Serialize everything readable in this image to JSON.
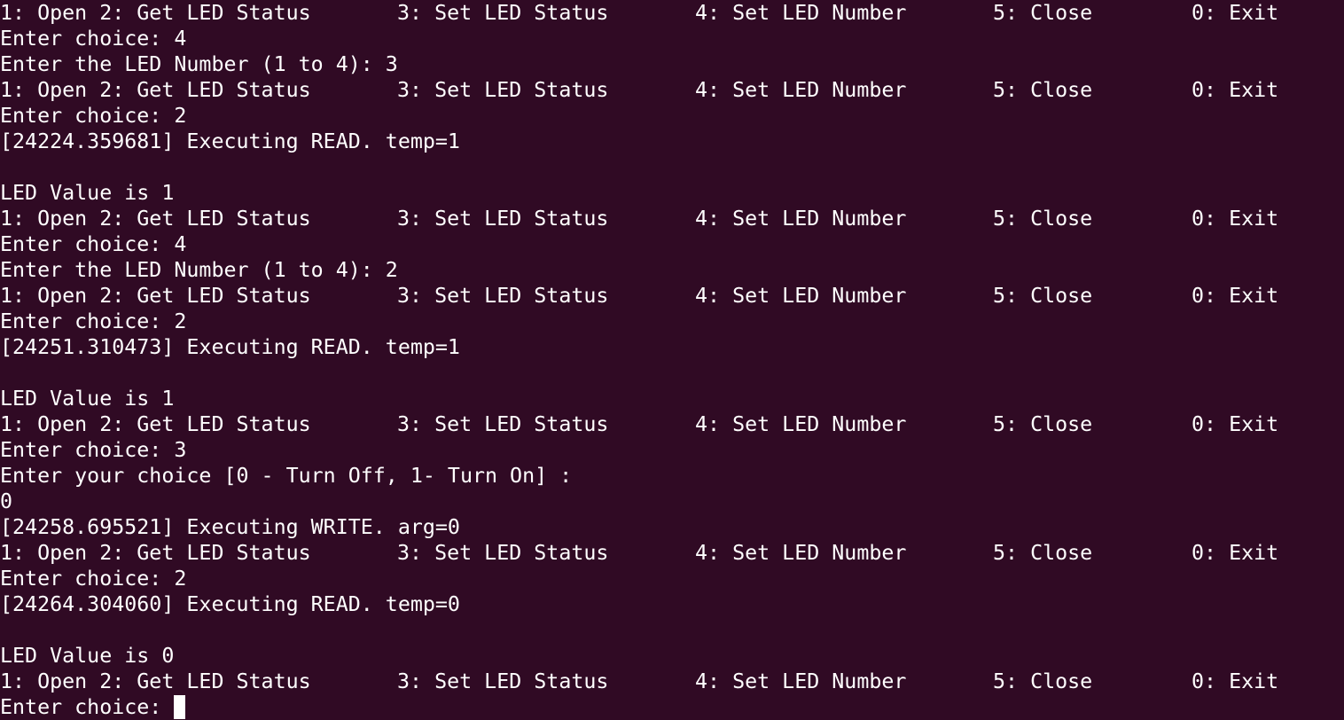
{
  "menu": {
    "item1": "1: Open 2: Get LED Status",
    "item3": "3: Set LED Status",
    "item4": "4: Set LED Number",
    "item5": "5: Close",
    "item0": "0: Exit"
  },
  "lines": [
    {
      "type": "menu"
    },
    {
      "type": "text",
      "text": "Enter choice: 4"
    },
    {
      "type": "text",
      "text": "Enter the LED Number (1 to 4): 3"
    },
    {
      "type": "menu"
    },
    {
      "type": "text",
      "text": "Enter choice: 2"
    },
    {
      "type": "text",
      "text": "[24224.359681] Executing READ. temp=1"
    },
    {
      "type": "text",
      "text": ""
    },
    {
      "type": "text",
      "text": "LED Value is 1"
    },
    {
      "type": "menu"
    },
    {
      "type": "text",
      "text": "Enter choice: 4"
    },
    {
      "type": "text",
      "text": "Enter the LED Number (1 to 4): 2"
    },
    {
      "type": "menu"
    },
    {
      "type": "text",
      "text": "Enter choice: 2"
    },
    {
      "type": "text",
      "text": "[24251.310473] Executing READ. temp=1"
    },
    {
      "type": "text",
      "text": ""
    },
    {
      "type": "text",
      "text": "LED Value is 1"
    },
    {
      "type": "menu"
    },
    {
      "type": "text",
      "text": "Enter choice: 3"
    },
    {
      "type": "text",
      "text": "Enter your choice [0 - Turn Off, 1- Turn On] :"
    },
    {
      "type": "text",
      "text": "0"
    },
    {
      "type": "text",
      "text": "[24258.695521] Executing WRITE. arg=0"
    },
    {
      "type": "menu"
    },
    {
      "type": "text",
      "text": "Enter choice: 2"
    },
    {
      "type": "text",
      "text": "[24264.304060] Executing READ. temp=0"
    },
    {
      "type": "text",
      "text": ""
    },
    {
      "type": "text",
      "text": "LED Value is 0"
    },
    {
      "type": "menu"
    },
    {
      "type": "prompt",
      "text": "Enter choice: "
    }
  ],
  "colors": {
    "background": "#300a24",
    "foreground": "#ffffff"
  }
}
